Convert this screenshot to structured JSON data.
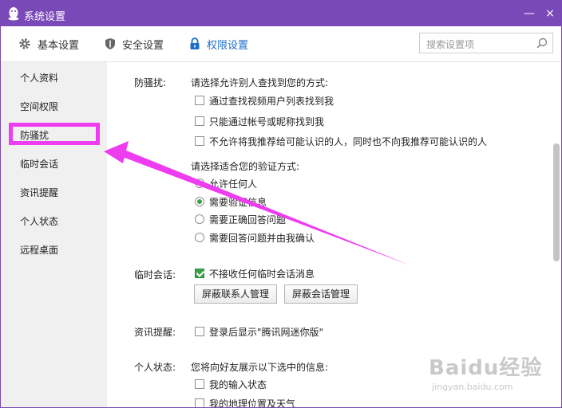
{
  "window": {
    "title": "系统设置",
    "close_glyph": "×",
    "minimize_glyph": "—"
  },
  "toolbar": {
    "tabs": [
      {
        "label": "基本设置",
        "icon": "gear-icon"
      },
      {
        "label": "安全设置",
        "icon": "shield-icon"
      },
      {
        "label": "权限设置",
        "icon": "lock-icon",
        "active": true
      }
    ],
    "search_placeholder": "搜索设置项"
  },
  "sidebar": {
    "items": [
      {
        "label": "个人资料"
      },
      {
        "label": "空间权限"
      },
      {
        "label": "防骚扰",
        "selected": true
      },
      {
        "label": "临时会话"
      },
      {
        "label": "资讯提醒"
      },
      {
        "label": "个人状态"
      },
      {
        "label": "远程桌面"
      }
    ]
  },
  "anti_harass": {
    "section_label": "防骚扰:",
    "find_prompt": "请选择允许别人查找到您的方式:",
    "find_options": [
      {
        "label": "通过查找视频用户列表找到我",
        "checked": false
      },
      {
        "label": "只能通过帐号或昵称找到我",
        "checked": false
      },
      {
        "label": "不允许将我推荐给可能认识的人，同时也不向我推荐可能认识的人",
        "checked": false
      }
    ],
    "verify_prompt": "请选择适合您的验证方式:",
    "verify_options": [
      {
        "label": "允许任何人",
        "checked": false
      },
      {
        "label": "需要验证信息",
        "checked": true
      },
      {
        "label": "需要正确回答问题",
        "checked": false
      },
      {
        "label": "需要回答问题并由我确认",
        "checked": false
      }
    ]
  },
  "temp_session": {
    "section_label": "临时会话:",
    "option": {
      "label": "不接收任何临时会话消息",
      "checked": true
    },
    "buttons": [
      "屏蔽联系人管理",
      "屏蔽会话管理"
    ]
  },
  "news": {
    "section_label": "资讯提醒:",
    "option": {
      "label": "登录后显示\"腾讯网迷你版\"",
      "checked": false
    }
  },
  "status": {
    "section_label": "个人状态:",
    "prompt": "您将向好友展示以下选中的信息:",
    "options": [
      {
        "label": "我的输入状态",
        "checked": false
      },
      {
        "label": "我的地理位置及天气",
        "checked": false
      }
    ]
  },
  "watermark": {
    "brand": "Baidu经验",
    "url": "jingyan.baidu.com"
  },
  "colors": {
    "titlebar": "#7a49b8",
    "accent": "#1d6fc9",
    "highlight": "#ee3cf0",
    "check": "#3aa24a"
  }
}
